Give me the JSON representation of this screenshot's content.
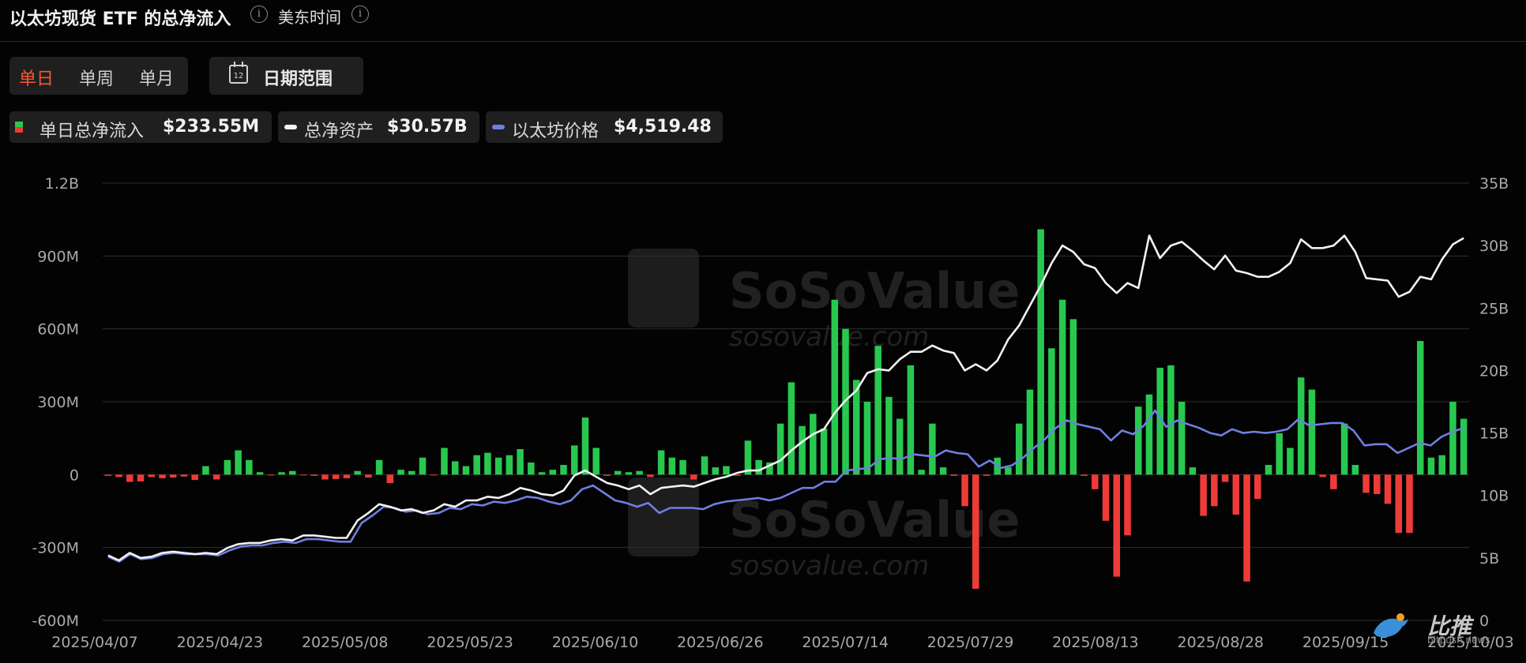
{
  "header": {
    "title": "以太坊现货 ETF 的总净流入",
    "timezone": "美东时间"
  },
  "period_tabs": [
    {
      "label": "单日",
      "active": true
    },
    {
      "label": "单周",
      "active": false
    },
    {
      "label": "单月",
      "active": false
    }
  ],
  "date_range": {
    "label": "日期范围",
    "day": "12"
  },
  "legend": {
    "flow": {
      "label": "单日总净流入",
      "value": "$233.55M"
    },
    "assets": {
      "label": "总净资产",
      "value": "$30.57B"
    },
    "price": {
      "label": "以太坊价格",
      "value": "$4,519.48"
    }
  },
  "watermark": {
    "brand": "SoSoValue",
    "domain": "sosovalue.com"
  },
  "corner_brand": {
    "name": "比推",
    "sub": "bitpush.news"
  },
  "colors": {
    "inflow": "#28c84f",
    "outflow": "#ef3b37",
    "assets_line": "#f2f2f2",
    "price_line": "#6f7fe0"
  },
  "chart_data": {
    "type": "bar",
    "x_tick_labels": [
      "2025/04/07",
      "2025/04/23",
      "2025/05/08",
      "2025/05/23",
      "2025/06/10",
      "2025/06/26",
      "2025/07/14",
      "2025/07/29",
      "2025/08/13",
      "2025/08/28",
      "2025/09/15",
      "2025/10/03"
    ],
    "y_left_ticks": [
      "1.2B",
      "900M",
      "600M",
      "300M",
      "0",
      "-300M",
      "-600M"
    ],
    "y_right_ticks": [
      "35B",
      "30B",
      "25B",
      "20B",
      "15B",
      "10B",
      "5B",
      "0"
    ],
    "ylim_left_millions": [
      -600,
      1200
    ],
    "ylim_right_billions": [
      0,
      35
    ],
    "grid": true,
    "series": [
      {
        "name": "单日总净流入",
        "type": "bar",
        "unit": "USD millions",
        "values": [
          -5,
          -10,
          -30,
          -28,
          -10,
          -15,
          -12,
          -8,
          -22,
          35,
          -20,
          60,
          100,
          60,
          10,
          -3,
          10,
          15,
          -3,
          -5,
          -20,
          -18,
          -15,
          15,
          -12,
          60,
          -35,
          20,
          15,
          70,
          -3,
          110,
          55,
          35,
          80,
          90,
          70,
          80,
          105,
          50,
          10,
          20,
          40,
          120,
          235,
          110,
          -5,
          15,
          10,
          15,
          -10,
          100,
          70,
          60,
          -20,
          75,
          30,
          35,
          -5,
          140,
          60,
          50,
          210,
          380,
          200,
          250,
          190,
          720,
          600,
          390,
          300,
          530,
          320,
          230,
          450,
          20,
          210,
          30,
          -5,
          -130,
          -470,
          -5,
          70,
          30,
          210,
          350,
          1010,
          520,
          720,
          640,
          -5,
          -60,
          -190,
          -420,
          -250,
          280,
          330,
          440,
          450,
          300,
          30,
          -170,
          -130,
          -30,
          -165,
          -440,
          -100,
          40,
          170,
          110,
          400,
          350,
          -10,
          -60,
          210,
          40,
          -75,
          -80,
          -120,
          -240,
          -240,
          550,
          70,
          80,
          300,
          230
        ]
      },
      {
        "name": "总净资产",
        "type": "line",
        "unit": "USD billions",
        "values": [
          5.2,
          4.8,
          5.4,
          5.0,
          5.1,
          5.4,
          5.5,
          5.4,
          5.3,
          5.4,
          5.3,
          5.8,
          6.1,
          6.2,
          6.2,
          6.4,
          6.5,
          6.4,
          6.8,
          6.8,
          6.7,
          6.6,
          6.6,
          8.0,
          8.6,
          9.3,
          9.1,
          8.8,
          8.9,
          8.6,
          8.8,
          9.3,
          9.1,
          9.6,
          9.6,
          9.9,
          9.8,
          10.1,
          10.6,
          10.4,
          10.1,
          10.0,
          10.4,
          11.6,
          12.0,
          11.5,
          11.0,
          10.8,
          10.5,
          10.8,
          10.1,
          10.6,
          10.7,
          10.8,
          10.7,
          11.0,
          11.3,
          11.5,
          11.8,
          12.0,
          12.0,
          12.4,
          12.8,
          13.6,
          14.3,
          14.9,
          15.3,
          16.6,
          17.6,
          18.4,
          19.8,
          20.1,
          20.0,
          20.9,
          21.5,
          21.5,
          22.0,
          21.6,
          21.4,
          20.0,
          20.5,
          20.0,
          20.8,
          22.5,
          23.6,
          25.2,
          26.8,
          28.6,
          30.0,
          29.5,
          28.5,
          28.2,
          27.0,
          26.2,
          27.0,
          26.6,
          30.8,
          29.0,
          30.0,
          30.3,
          29.6,
          28.8,
          28.1,
          29.2,
          28.0,
          27.8,
          27.5,
          27.5,
          27.9,
          28.6,
          30.5,
          29.8,
          29.8,
          30.0,
          30.8,
          29.5,
          27.4,
          27.3,
          27.2,
          25.9,
          26.3,
          27.5,
          27.3,
          28.9,
          30.1,
          30.6
        ]
      },
      {
        "name": "以太坊价格",
        "type": "line",
        "unit": "right-axis billions (as plotted)",
        "values": [
          5.1,
          4.7,
          5.3,
          4.9,
          5.0,
          5.3,
          5.4,
          5.3,
          5.3,
          5.3,
          5.2,
          5.6,
          5.9,
          6.0,
          6.0,
          6.2,
          6.3,
          6.2,
          6.5,
          6.5,
          6.4,
          6.3,
          6.3,
          7.8,
          8.4,
          9.1,
          9.0,
          8.7,
          8.8,
          8.5,
          8.6,
          9.0,
          8.9,
          9.3,
          9.2,
          9.5,
          9.4,
          9.6,
          9.9,
          9.8,
          9.5,
          9.3,
          9.6,
          10.5,
          10.8,
          10.2,
          9.6,
          9.4,
          9.1,
          9.4,
          8.6,
          9.0,
          9.0,
          9.0,
          8.9,
          9.3,
          9.5,
          9.6,
          9.7,
          9.8,
          9.6,
          9.8,
          10.2,
          10.6,
          10.6,
          11.1,
          11.1,
          12.0,
          12.1,
          12.2,
          12.9,
          13.0,
          12.9,
          13.3,
          13.2,
          13.1,
          13.6,
          13.4,
          13.3,
          12.3,
          12.8,
          12.2,
          12.4,
          13.0,
          13.8,
          14.5,
          15.4,
          16.0,
          15.7,
          15.5,
          15.3,
          14.4,
          15.2,
          14.9,
          15.6,
          16.8,
          15.5,
          16.0,
          15.7,
          15.4,
          15.0,
          14.8,
          15.3,
          15.0,
          15.1,
          15.0,
          15.1,
          15.3,
          16.1,
          15.6,
          15.7,
          15.8,
          15.8,
          15.2,
          14.0,
          14.1,
          14.1,
          13.4,
          13.8,
          14.2,
          14.0,
          14.7,
          15.1,
          15.4
        ]
      }
    ]
  }
}
